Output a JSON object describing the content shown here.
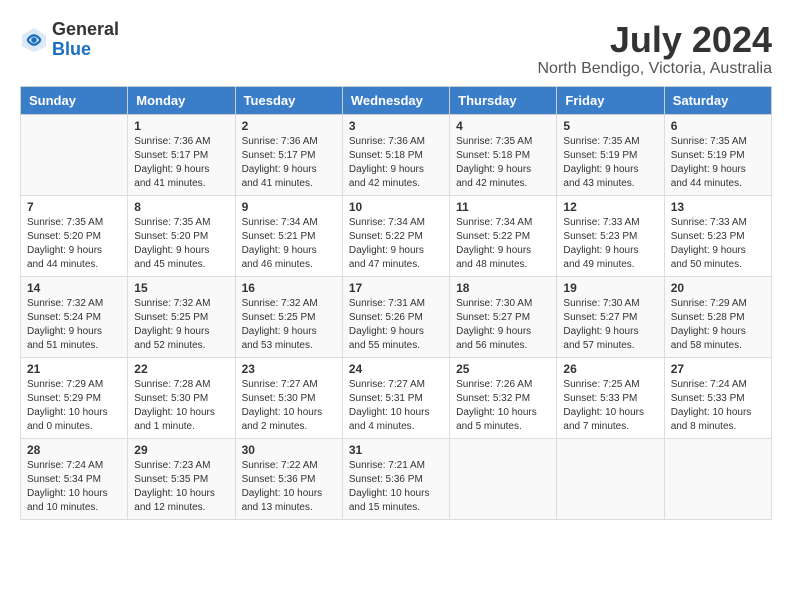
{
  "logo": {
    "general": "General",
    "blue": "Blue"
  },
  "title": "July 2024",
  "location": "North Bendigo, Victoria, Australia",
  "days_header": [
    "Sunday",
    "Monday",
    "Tuesday",
    "Wednesday",
    "Thursday",
    "Friday",
    "Saturday"
  ],
  "weeks": [
    [
      {
        "day": "",
        "info": ""
      },
      {
        "day": "1",
        "info": "Sunrise: 7:36 AM\nSunset: 5:17 PM\nDaylight: 9 hours\nand 41 minutes."
      },
      {
        "day": "2",
        "info": "Sunrise: 7:36 AM\nSunset: 5:17 PM\nDaylight: 9 hours\nand 41 minutes."
      },
      {
        "day": "3",
        "info": "Sunrise: 7:36 AM\nSunset: 5:18 PM\nDaylight: 9 hours\nand 42 minutes."
      },
      {
        "day": "4",
        "info": "Sunrise: 7:35 AM\nSunset: 5:18 PM\nDaylight: 9 hours\nand 42 minutes."
      },
      {
        "day": "5",
        "info": "Sunrise: 7:35 AM\nSunset: 5:19 PM\nDaylight: 9 hours\nand 43 minutes."
      },
      {
        "day": "6",
        "info": "Sunrise: 7:35 AM\nSunset: 5:19 PM\nDaylight: 9 hours\nand 44 minutes."
      }
    ],
    [
      {
        "day": "7",
        "info": "Sunrise: 7:35 AM\nSunset: 5:20 PM\nDaylight: 9 hours\nand 44 minutes."
      },
      {
        "day": "8",
        "info": "Sunrise: 7:35 AM\nSunset: 5:20 PM\nDaylight: 9 hours\nand 45 minutes."
      },
      {
        "day": "9",
        "info": "Sunrise: 7:34 AM\nSunset: 5:21 PM\nDaylight: 9 hours\nand 46 minutes."
      },
      {
        "day": "10",
        "info": "Sunrise: 7:34 AM\nSunset: 5:22 PM\nDaylight: 9 hours\nand 47 minutes."
      },
      {
        "day": "11",
        "info": "Sunrise: 7:34 AM\nSunset: 5:22 PM\nDaylight: 9 hours\nand 48 minutes."
      },
      {
        "day": "12",
        "info": "Sunrise: 7:33 AM\nSunset: 5:23 PM\nDaylight: 9 hours\nand 49 minutes."
      },
      {
        "day": "13",
        "info": "Sunrise: 7:33 AM\nSunset: 5:23 PM\nDaylight: 9 hours\nand 50 minutes."
      }
    ],
    [
      {
        "day": "14",
        "info": "Sunrise: 7:32 AM\nSunset: 5:24 PM\nDaylight: 9 hours\nand 51 minutes."
      },
      {
        "day": "15",
        "info": "Sunrise: 7:32 AM\nSunset: 5:25 PM\nDaylight: 9 hours\nand 52 minutes."
      },
      {
        "day": "16",
        "info": "Sunrise: 7:32 AM\nSunset: 5:25 PM\nDaylight: 9 hours\nand 53 minutes."
      },
      {
        "day": "17",
        "info": "Sunrise: 7:31 AM\nSunset: 5:26 PM\nDaylight: 9 hours\nand 55 minutes."
      },
      {
        "day": "18",
        "info": "Sunrise: 7:30 AM\nSunset: 5:27 PM\nDaylight: 9 hours\nand 56 minutes."
      },
      {
        "day": "19",
        "info": "Sunrise: 7:30 AM\nSunset: 5:27 PM\nDaylight: 9 hours\nand 57 minutes."
      },
      {
        "day": "20",
        "info": "Sunrise: 7:29 AM\nSunset: 5:28 PM\nDaylight: 9 hours\nand 58 minutes."
      }
    ],
    [
      {
        "day": "21",
        "info": "Sunrise: 7:29 AM\nSunset: 5:29 PM\nDaylight: 10 hours\nand 0 minutes."
      },
      {
        "day": "22",
        "info": "Sunrise: 7:28 AM\nSunset: 5:30 PM\nDaylight: 10 hours\nand 1 minute."
      },
      {
        "day": "23",
        "info": "Sunrise: 7:27 AM\nSunset: 5:30 PM\nDaylight: 10 hours\nand 2 minutes."
      },
      {
        "day": "24",
        "info": "Sunrise: 7:27 AM\nSunset: 5:31 PM\nDaylight: 10 hours\nand 4 minutes."
      },
      {
        "day": "25",
        "info": "Sunrise: 7:26 AM\nSunset: 5:32 PM\nDaylight: 10 hours\nand 5 minutes."
      },
      {
        "day": "26",
        "info": "Sunrise: 7:25 AM\nSunset: 5:33 PM\nDaylight: 10 hours\nand 7 minutes."
      },
      {
        "day": "27",
        "info": "Sunrise: 7:24 AM\nSunset: 5:33 PM\nDaylight: 10 hours\nand 8 minutes."
      }
    ],
    [
      {
        "day": "28",
        "info": "Sunrise: 7:24 AM\nSunset: 5:34 PM\nDaylight: 10 hours\nand 10 minutes."
      },
      {
        "day": "29",
        "info": "Sunrise: 7:23 AM\nSunset: 5:35 PM\nDaylight: 10 hours\nand 12 minutes."
      },
      {
        "day": "30",
        "info": "Sunrise: 7:22 AM\nSunset: 5:36 PM\nDaylight: 10 hours\nand 13 minutes."
      },
      {
        "day": "31",
        "info": "Sunrise: 7:21 AM\nSunset: 5:36 PM\nDaylight: 10 hours\nand 15 minutes."
      },
      {
        "day": "",
        "info": ""
      },
      {
        "day": "",
        "info": ""
      },
      {
        "day": "",
        "info": ""
      }
    ]
  ]
}
